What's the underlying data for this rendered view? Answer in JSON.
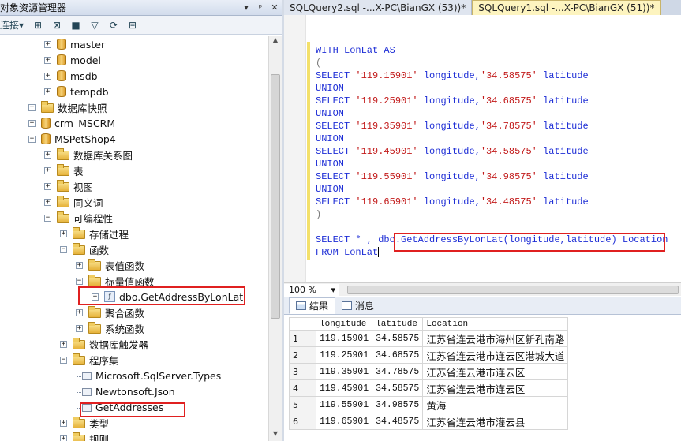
{
  "object_explorer": {
    "title": "对象资源管理器",
    "title_controls": [
      "▾",
      "ᵖ",
      "✕"
    ],
    "toolbar": {
      "connect_label": "连接"
    },
    "tree": [
      {
        "label": "master",
        "icon": "database",
        "expander": "+"
      },
      {
        "label": "model",
        "icon": "database",
        "expander": "+"
      },
      {
        "label": "msdb",
        "icon": "database",
        "expander": "+"
      },
      {
        "label": "tempdb",
        "icon": "database",
        "expander": "+"
      },
      {
        "label": "数据库快照",
        "icon": "folder",
        "expander": "+"
      },
      {
        "label": "crm_MSCRM",
        "icon": "database",
        "expander": "+"
      },
      {
        "label": "MSPetShop4",
        "icon": "database",
        "expander": "−"
      },
      {
        "label": "数据库关系图",
        "icon": "folder",
        "expander": "+"
      },
      {
        "label": "表",
        "icon": "folder",
        "expander": "+"
      },
      {
        "label": "视图",
        "icon": "folder",
        "expander": "+"
      },
      {
        "label": "同义词",
        "icon": "folder",
        "expander": "+"
      },
      {
        "label": "可编程性",
        "icon": "folder",
        "expander": "−"
      },
      {
        "label": "存储过程",
        "icon": "folder",
        "expander": "+"
      },
      {
        "label": "函数",
        "icon": "folder",
        "expander": "−"
      },
      {
        "label": "表值函数",
        "icon": "folder",
        "expander": "+"
      },
      {
        "label": "标量值函数",
        "icon": "folder",
        "expander": "−"
      },
      {
        "label": "dbo.GetAddressByLonLat",
        "icon": "function",
        "expander": "+"
      },
      {
        "label": "聚合函数",
        "icon": "folder",
        "expander": "+"
      },
      {
        "label": "系统函数",
        "icon": "folder",
        "expander": "+"
      },
      {
        "label": "数据库触发器",
        "icon": "folder",
        "expander": "+"
      },
      {
        "label": "程序集",
        "icon": "folder",
        "expander": "−"
      },
      {
        "label": "Microsoft.SqlServer.Types",
        "icon": "assembly",
        "expander": ""
      },
      {
        "label": "Newtonsoft.Json",
        "icon": "assembly",
        "expander": ""
      },
      {
        "label": "GetAddresses",
        "icon": "assembly",
        "expander": ""
      },
      {
        "label": "类型",
        "icon": "folder",
        "expander": "+"
      },
      {
        "label": "规则",
        "icon": "folder",
        "expander": "+"
      }
    ]
  },
  "editor": {
    "tabs": [
      {
        "label": "SQLQuery2.sql -...X-PC\\BianGX (53))*",
        "active": false
      },
      {
        "label": "SQLQuery1.sql -...X-PC\\BianGX (51))*",
        "active": true
      }
    ],
    "code_lines": [
      {
        "kind": "with",
        "text": "WITH LonLat AS"
      },
      {
        "kind": "paren",
        "text": "("
      },
      {
        "kind": "select",
        "lon": "'119.15901'",
        "lat": "'34.58575'"
      },
      {
        "kind": "union",
        "text": "UNION"
      },
      {
        "kind": "select",
        "lon": "'119.25901'",
        "lat": "'34.68575'"
      },
      {
        "kind": "union",
        "text": "UNION"
      },
      {
        "kind": "select",
        "lon": "'119.35901'",
        "lat": "'34.78575'"
      },
      {
        "kind": "union",
        "text": "UNION"
      },
      {
        "kind": "select",
        "lon": "'119.45901'",
        "lat": "'34.58575'"
      },
      {
        "kind": "union",
        "text": "UNION"
      },
      {
        "kind": "select",
        "lon": "'119.55901'",
        "lat": "'34.98575'"
      },
      {
        "kind": "union",
        "text": "UNION"
      },
      {
        "kind": "select",
        "lon": "'119.65901'",
        "lat": "'34.48575'"
      },
      {
        "kind": "paren",
        "text": ")"
      },
      {
        "kind": "blank",
        "text": ""
      },
      {
        "kind": "final",
        "text": "SELECT * , dbo.GetAddressByLonLat(longitude,latitude) Location"
      },
      {
        "kind": "from",
        "text": "FROM LonLat"
      }
    ],
    "tokens": {
      "select": "SELECT",
      "longitude_alias": "longitude,",
      "latitude_alias": "latitude",
      "union": "UNION"
    },
    "zoom": "100 %"
  },
  "results": {
    "tabs": [
      {
        "label": "结果",
        "active": true
      },
      {
        "label": "消息",
        "active": false
      }
    ],
    "columns": [
      "longitude",
      "latitude",
      "Location"
    ],
    "rows": [
      {
        "n": "1",
        "longitude": "119.15901",
        "latitude": "34.58575",
        "location": "江苏省连云港市海州区新孔南路"
      },
      {
        "n": "2",
        "longitude": "119.25901",
        "latitude": "34.68575",
        "location": "江苏省连云港市连云区港城大道"
      },
      {
        "n": "3",
        "longitude": "119.35901",
        "latitude": "34.78575",
        "location": "江苏省连云港市连云区"
      },
      {
        "n": "4",
        "longitude": "119.45901",
        "latitude": "34.58575",
        "location": "江苏省连云港市连云区"
      },
      {
        "n": "5",
        "longitude": "119.55901",
        "latitude": "34.98575",
        "location": "黄海"
      },
      {
        "n": "6",
        "longitude": "119.65901",
        "latitude": "34.48575",
        "location": "江苏省连云港市灌云县"
      }
    ]
  },
  "colors": {
    "keyword": "#1f2fd6",
    "string": "#c21a1a",
    "highlight_box": "#e02020",
    "active_tab": "#fdf4bf"
  }
}
